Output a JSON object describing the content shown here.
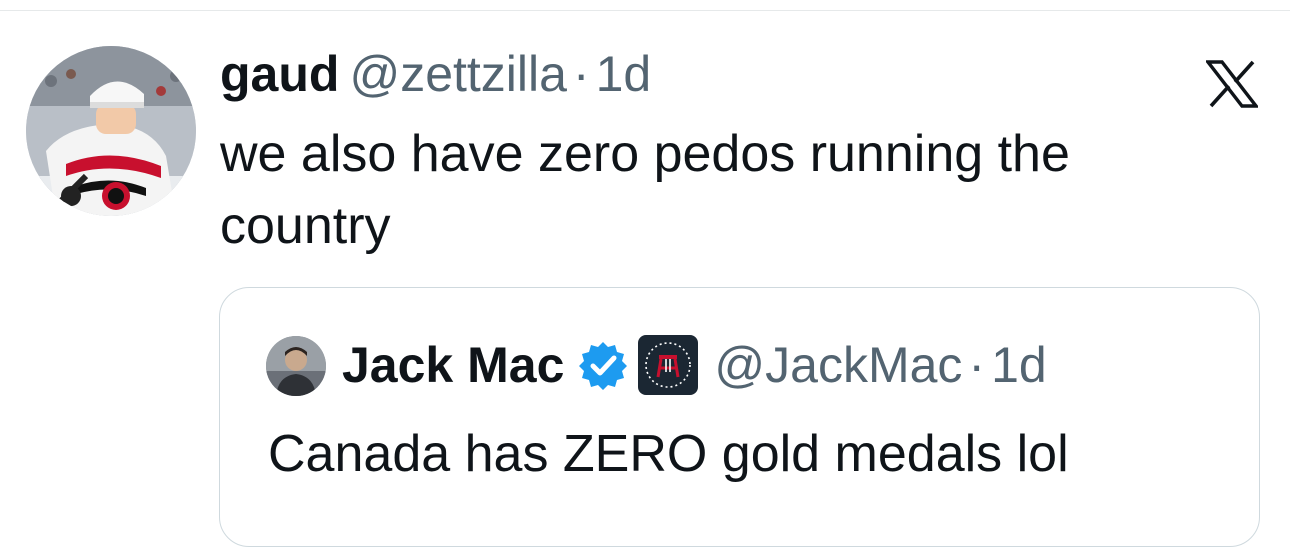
{
  "tweet": {
    "display_name": "gaud",
    "handle": "@zettzilla",
    "separator": "·",
    "time": "1d",
    "text": "we also have zero pedos running the country",
    "avatar_icon": "hockey-player-avatar"
  },
  "app": {
    "logo_icon": "x-logo-icon"
  },
  "quote": {
    "display_name": "Jack Mac",
    "verified_icon": "verified-badge-icon",
    "verified_color": "#1d9bf0",
    "affiliate_icon": "barstool-affiliate-badge-icon",
    "handle": "@JackMac",
    "separator": "·",
    "time": "1d",
    "text": "Canada has ZERO gold medals lol"
  },
  "colors": {
    "text_primary": "#0f1419",
    "text_secondary": "#536471",
    "border": "#cfd9de"
  }
}
